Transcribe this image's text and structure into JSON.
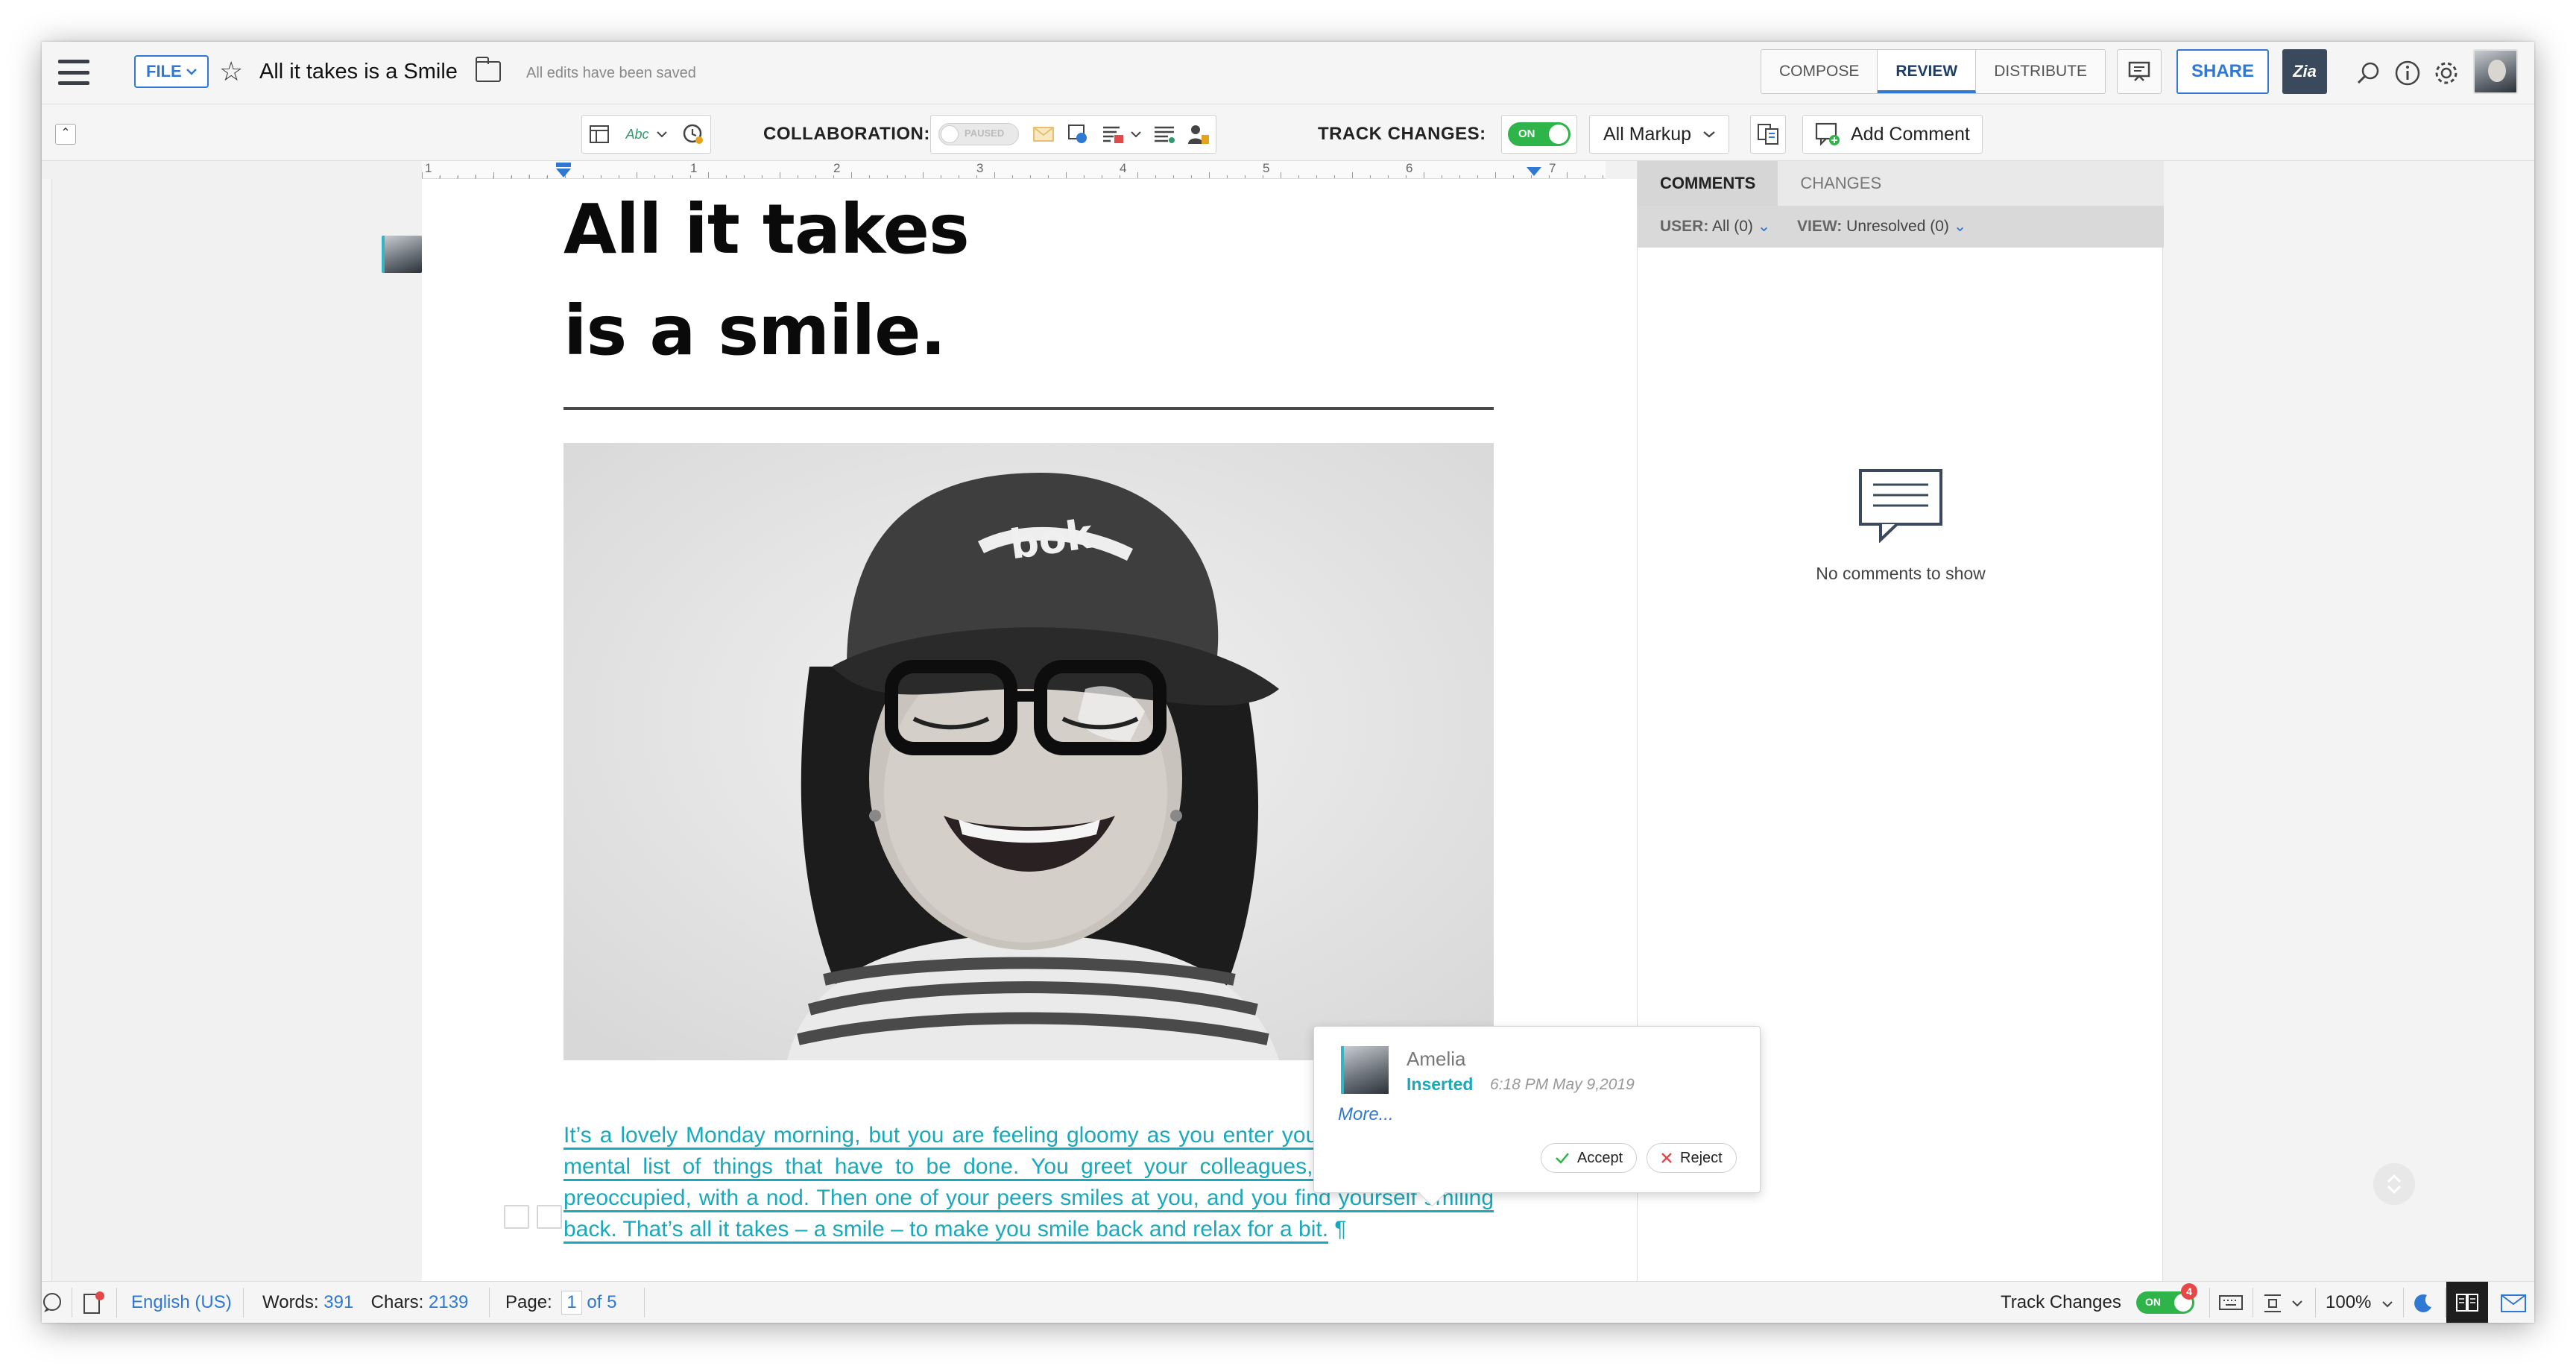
{
  "topbar": {
    "file_label": "FILE",
    "doc_title": "All it takes is a Smile",
    "save_status": "All edits have been saved",
    "tabs": [
      {
        "label": "COMPOSE"
      },
      {
        "label": "REVIEW"
      },
      {
        "label": "DISTRIBUTE"
      }
    ],
    "share_label": "SHARE",
    "zia_label": "Zia"
  },
  "toolbar": {
    "collaboration_label": "COLLABORATION:",
    "collaboration_toggle": "PAUSED",
    "track_changes_label": "TRACK CHANGES:",
    "track_toggle": "ON",
    "markup_select": "All Markup",
    "add_comment_label": "Add Comment"
  },
  "ruler": {
    "numbers": [
      "1",
      "1",
      "2",
      "3",
      "4",
      "5",
      "6",
      "7"
    ]
  },
  "document": {
    "heading_line1": "All it takes",
    "heading_line2": "is a smile.",
    "body": "It’s a lovely Monday morning, but you are feeling gloomy as you enter your office, making a mental list of things that have to be done. You greet your colleagues, who are equally preoccupied, with a nod. Then one of your peers smiles at you, and you find yourself smiling back. That’s all it takes – a smile – to make you smile back and relax for a bit.",
    "pilcrow": "¶"
  },
  "panel": {
    "tabs": [
      {
        "label": "COMMENTS"
      },
      {
        "label": "CHANGES"
      }
    ],
    "user_label": "USER:",
    "user_value": "All (0)",
    "view_label": "VIEW:",
    "view_value": "Unresolved (0)",
    "empty_message": "No comments to show"
  },
  "popup": {
    "author": "Amelia",
    "action": "Inserted",
    "time": "6:18 PM May 9,2019",
    "more": "More...",
    "accept": "Accept",
    "reject": "Reject"
  },
  "statusbar": {
    "language": "English (US)",
    "words_label": "Words:",
    "words_value": "391",
    "chars_label": "Chars:",
    "chars_value": "2139",
    "page_label": "Page:",
    "page_value": "1",
    "page_of": "of 5",
    "track_label": "Track Changes",
    "track_toggle": "ON",
    "track_badge": "4",
    "zoom": "100%"
  },
  "colors": {
    "accent": "#2f78d3",
    "insert": "#1aa9bb",
    "toggle_on": "#2fb44a"
  }
}
